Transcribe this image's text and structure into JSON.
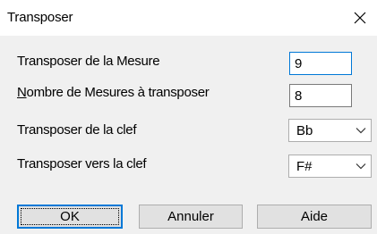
{
  "window": {
    "title": "Transposer"
  },
  "fields": {
    "start_bar": {
      "label": "Transposer de la Mesure",
      "value": "9"
    },
    "bar_count": {
      "label": "Nombre de Mesures à transposer",
      "value": "8"
    },
    "from_key": {
      "label": "Transposer de la clef",
      "selected": "Bb"
    },
    "to_key": {
      "label": "Transposer vers la clef",
      "selected": "F#"
    }
  },
  "buttons": {
    "ok": "OK",
    "cancel": "Annuler",
    "help": "Aide"
  },
  "icons": {
    "close": "close-icon",
    "dropdown": "chevron-down-icon"
  },
  "colors": {
    "focus": "#0078d7",
    "dialog_bg": "#f0f0f0",
    "button_bg": "#e1e1e1"
  }
}
